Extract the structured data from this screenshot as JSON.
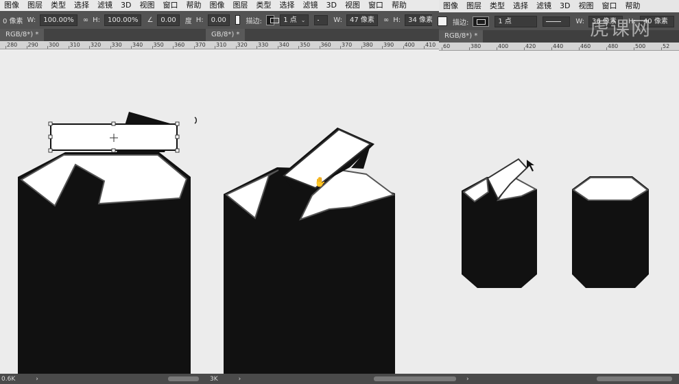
{
  "menu_left": [
    "图像",
    "图层",
    "类型",
    "选择",
    "滤镜",
    "3D",
    "视图",
    "窗口",
    "帮助",
    "图像",
    "图层",
    "类型",
    "选择",
    "滤镜",
    "3D",
    "视图",
    "窗口",
    "帮助"
  ],
  "menu_right": [
    "图像",
    "图层",
    "类型",
    "选择",
    "滤镜",
    "3D",
    "视图",
    "窗口",
    "帮助"
  ],
  "options_left": {
    "x_value": "0 像素",
    "w_label": "W:",
    "w_value": "100.00%",
    "link_icon": "link-icon",
    "h_label": "H:",
    "h_value": "100.00%",
    "angle_value": "0.00",
    "angle_unit": "度",
    "h2_label": "H:",
    "h2_value": "0.00",
    "stroke_label": "描边:",
    "stroke_size": "1 点",
    "w2_label": "W:",
    "w2_value": "47 像素",
    "h3_label": "H:",
    "h3_value": "34 像素"
  },
  "options_right": {
    "stroke_label": "描边:",
    "stroke_size": "1 点",
    "w_label": "W:",
    "w_value": "36 像素",
    "h_label": "H:",
    "h_value": "40 像素"
  },
  "tabs": {
    "tab1": "RGB/8*) *",
    "tab2": "GB/8*) *",
    "tab3": "RGB/8*) *"
  },
  "ruler_left": [
    "280",
    "290",
    "300",
    "310",
    "320",
    "330",
    "340",
    "350",
    "360",
    "370",
    "310",
    "320",
    "330",
    "340",
    "350",
    "360",
    "370",
    "380",
    "390",
    "400",
    "410"
  ],
  "ruler_right": [
    "60",
    "380",
    "400",
    "420",
    "440",
    "460",
    "480",
    "500",
    "52"
  ],
  "status": {
    "left": "0.6K",
    "middle": "3K",
    "arrow": "›"
  },
  "watermark": "虎课网"
}
